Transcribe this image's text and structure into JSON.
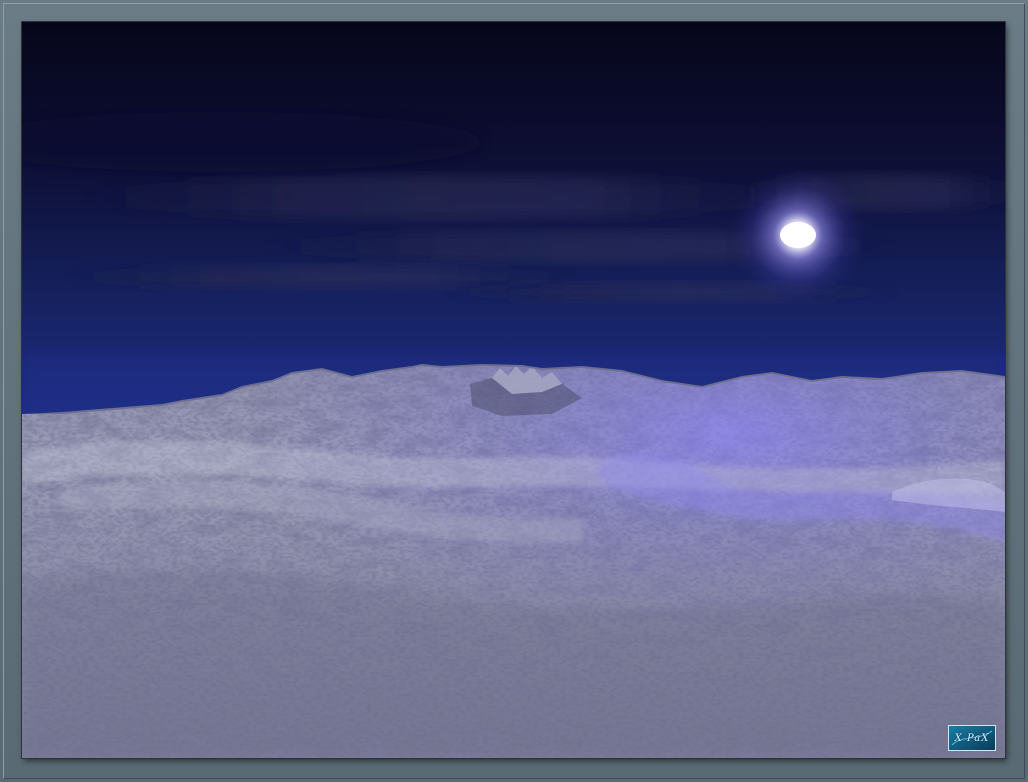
{
  "image": {
    "subject": "moonlit-snowy-terrain",
    "colors": {
      "frame": "#5e6f7a",
      "sky_top": "#07061a",
      "sky_horizon": "#1c2a7a",
      "moon": "#ffffff",
      "moon_glow": "#8f86ff",
      "terrain_light": "#b4b6cc",
      "terrain_dark": "#4a4c66",
      "terrain_lit": "#7f78e8"
    }
  },
  "watermark": {
    "text": "X PaX"
  }
}
